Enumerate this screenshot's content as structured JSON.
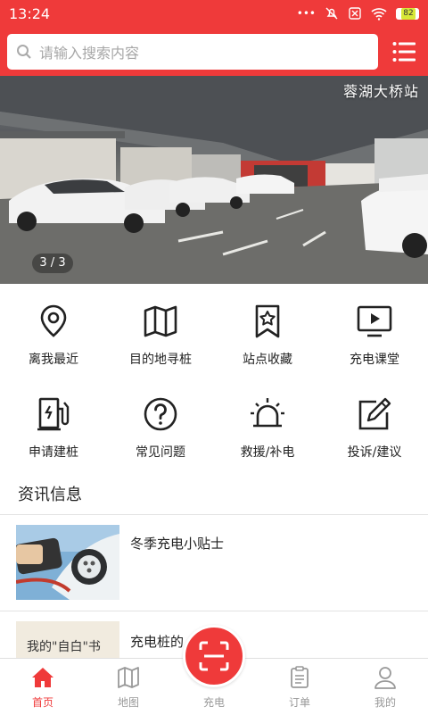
{
  "status_bar": {
    "time": "13:24",
    "signal_text": "•••",
    "battery": "82"
  },
  "search": {
    "placeholder": "请输入搜索内容"
  },
  "banner": {
    "station_name": "蓉湖大桥站",
    "pager": "3 / 3"
  },
  "grid": {
    "row1": [
      {
        "label": "离我最近",
        "icon": "location-pin-icon"
      },
      {
        "label": "目的地寻桩",
        "icon": "map-icon"
      },
      {
        "label": "站点收藏",
        "icon": "bookmark-star-icon"
      },
      {
        "label": "充电课堂",
        "icon": "video-play-icon"
      }
    ],
    "row2": [
      {
        "label": "申请建桩",
        "icon": "charging-pile-icon"
      },
      {
        "label": "常见问题",
        "icon": "question-icon"
      },
      {
        "label": "救援/补电",
        "icon": "alarm-light-icon"
      },
      {
        "label": "投诉/建议",
        "icon": "edit-icon"
      }
    ]
  },
  "news": {
    "title": "资讯信息",
    "items": [
      {
        "title": "冬季充电小贴士"
      },
      {
        "title": "充电桩的",
        "thumb_text": "我的\"自白\"书"
      }
    ]
  },
  "tabbar": {
    "tabs": [
      {
        "label": "首页",
        "icon": "home-icon"
      },
      {
        "label": "地图",
        "icon": "map-icon"
      },
      {
        "label": "充电",
        "icon": "scan-icon"
      },
      {
        "label": "订单",
        "icon": "order-list-icon"
      },
      {
        "label": "我的",
        "icon": "user-icon"
      }
    ]
  },
  "colors": {
    "accent": "#ef3a3a",
    "text": "#222222",
    "muted": "#999999"
  }
}
